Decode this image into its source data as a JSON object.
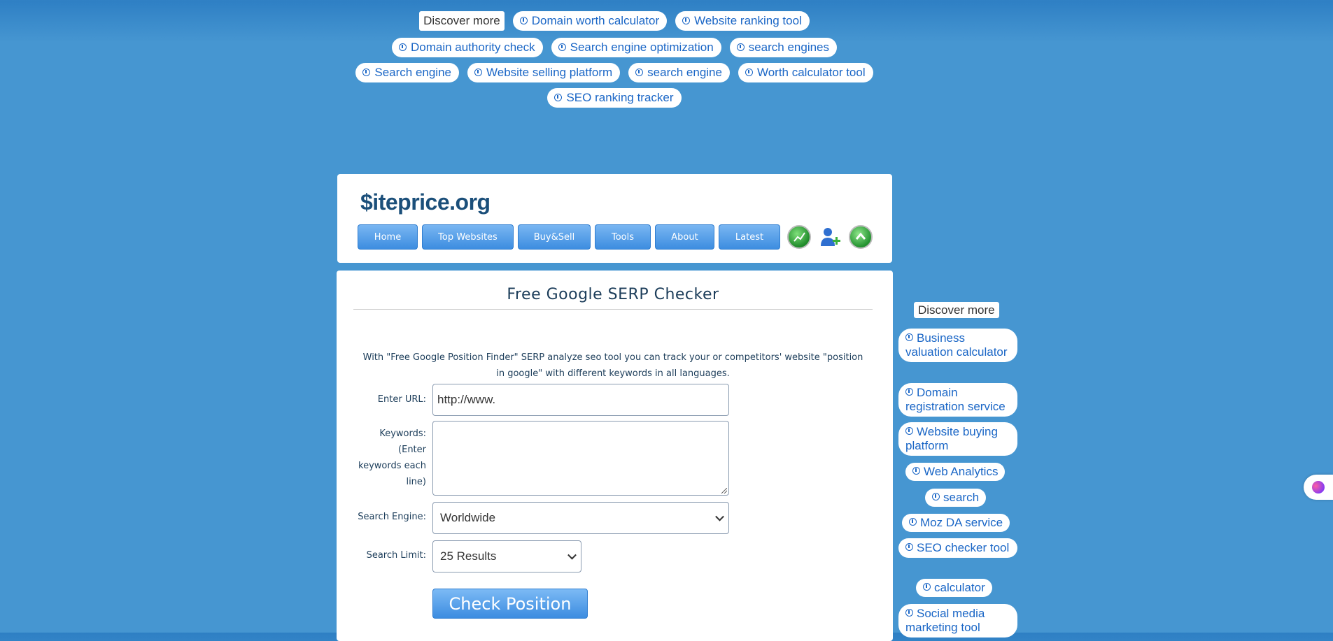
{
  "top_ads": {
    "discover_label": "Discover more",
    "row1": [
      "Domain worth calculator",
      "Website ranking tool"
    ],
    "row2": [
      "Domain authority check",
      "Search engine optimization",
      "search engines"
    ],
    "row3": [
      "Search engine",
      "Website selling platform",
      "search engine",
      "Worth calculator tool"
    ],
    "row4": [
      "SEO ranking tracker"
    ]
  },
  "header": {
    "logo": "$iteprice.org",
    "nav": [
      "Home",
      "Top Websites",
      "Buy&Sell",
      "Tools",
      "About",
      "Latest"
    ],
    "icons": [
      "graph-icon",
      "add-user-icon",
      "scroll-up-icon"
    ]
  },
  "main": {
    "title": "Free Google SERP Checker",
    "intro": "With \"Free Google Position Finder\" SERP analyze seo tool you can track your or competitors' website \"position in google\" with different keywords in all languages.",
    "url_label": "Enter URL:",
    "url_value": "http://www.",
    "keywords_label": "Keywords: (Enter keywords each line)",
    "keywords_value": "",
    "engine_label": "Search Engine:",
    "engine_value": "Worldwide",
    "limit_label": "Search Limit:",
    "limit_value": "25 Results",
    "submit_label": "Check Position"
  },
  "sidebar": {
    "discover_label": "Discover more",
    "items": [
      "Business valuation calculator",
      "Domain registration service",
      "Website buying platform",
      "Web Analytics",
      "search",
      "Moz DA service",
      "SEO checker tool",
      "calculator",
      "Social media marketing tool"
    ]
  },
  "colors": {
    "background": "#4696d1",
    "accent": "#3d8de0",
    "link": "#1a66c6",
    "logo": "#1b4f7a"
  }
}
